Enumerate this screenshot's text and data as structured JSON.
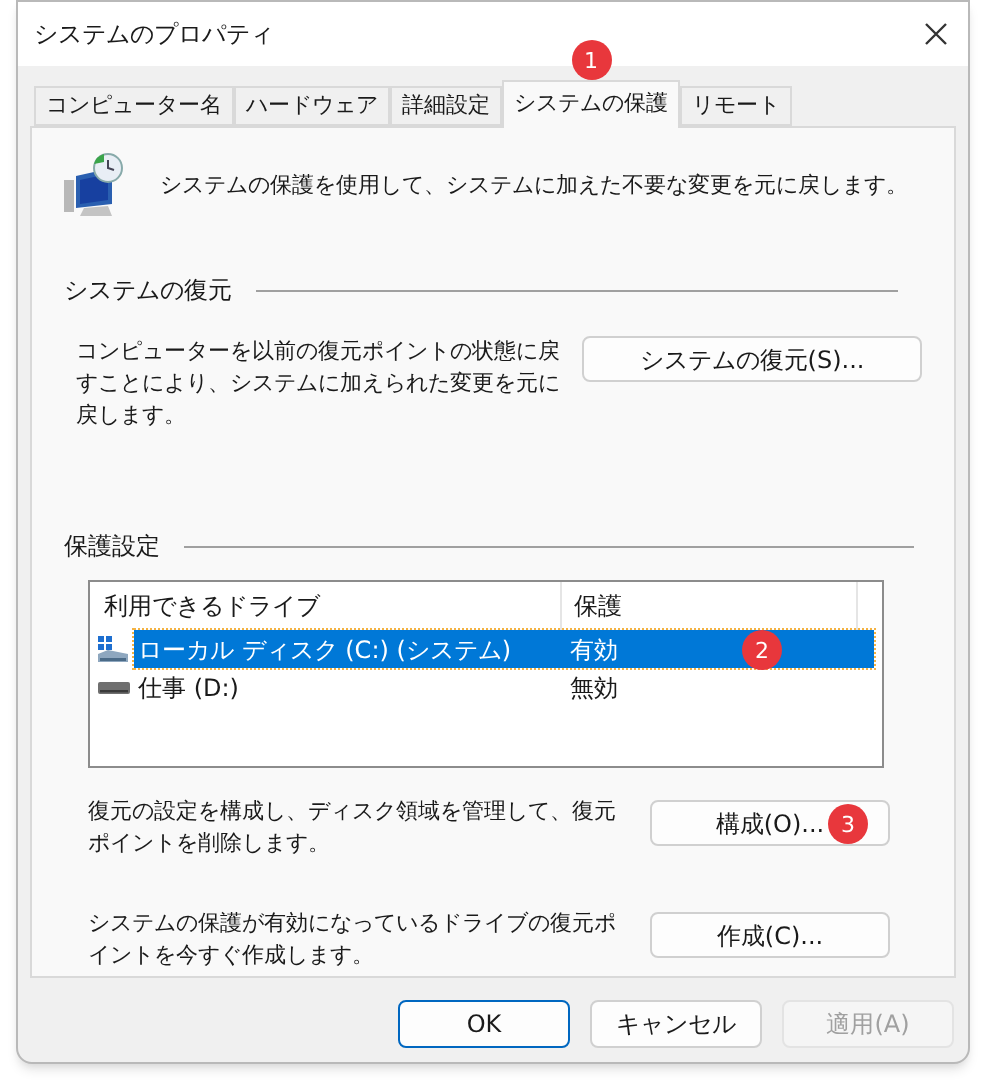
{
  "window": {
    "title": "システムのプロパティ"
  },
  "tabs": [
    {
      "label": "コンピューター名",
      "selected": false
    },
    {
      "label": "ハードウェア",
      "selected": false
    },
    {
      "label": "詳細設定",
      "selected": false
    },
    {
      "label": "システムの保護",
      "selected": true,
      "badge": "1"
    },
    {
      "label": "リモート",
      "selected": false
    }
  ],
  "description": "システムの保護を使用して、システムに加えた不要な変更を元に戻します。",
  "restore_section": {
    "heading": "システムの復元",
    "text": "コンピューターを以前の復元ポイントの状態に戻すことにより、システムに加えられた変更を元に戻します。",
    "button": "システムの復元(S)..."
  },
  "protection_section": {
    "heading": "保護設定",
    "columns": [
      "利用できるドライブ",
      "保護"
    ],
    "drives": [
      {
        "name": "ローカル ディスク (C:) (システム)",
        "protection": "有効",
        "selected": true,
        "kind": "system",
        "badge": "2"
      },
      {
        "name": "仕事 (D:)",
        "protection": "無効",
        "selected": false,
        "kind": "data"
      }
    ],
    "actions": [
      {
        "text": "復元の設定を構成し、ディスク領域を管理して、復元ポイントを削除します。",
        "button": "構成(O)...",
        "badge": "3"
      },
      {
        "text": "システムの保護が有効になっているドライブの復元ポイントを今すぐ作成します。",
        "button": "作成(C)..."
      }
    ]
  },
  "footer_buttons": [
    {
      "label": "OK",
      "kind": "default",
      "disabled": false
    },
    {
      "label": "キャンセル",
      "kind": "normal",
      "disabled": false
    },
    {
      "label": "適用(A)",
      "kind": "normal",
      "disabled": true
    }
  ]
}
